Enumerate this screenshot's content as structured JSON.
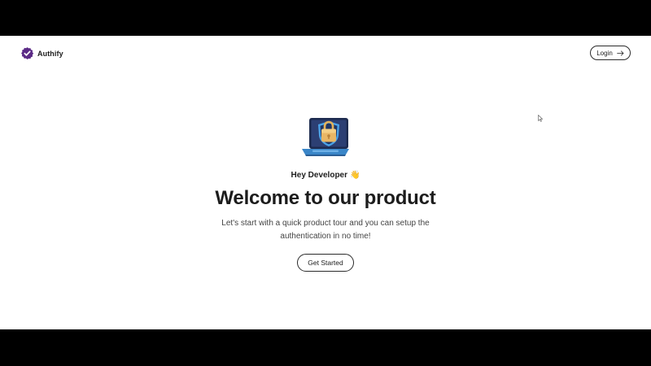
{
  "header": {
    "brand_name": "Authify",
    "brand_color": "#5b2a86",
    "login_label": "Login"
  },
  "hero": {
    "illustration": "laptop-lock-illustration",
    "greeting": "Hey Developer",
    "wave_emoji": "👋",
    "title": "Welcome to our product",
    "subtitle": "Let's start with a quick product tour and you can setup the authentication in no time!",
    "cta_label": "Get Started"
  },
  "icons": {
    "brand": "badge-check-icon",
    "login": "arrow-right-icon",
    "cursor": "mouse-pointer-icon"
  }
}
